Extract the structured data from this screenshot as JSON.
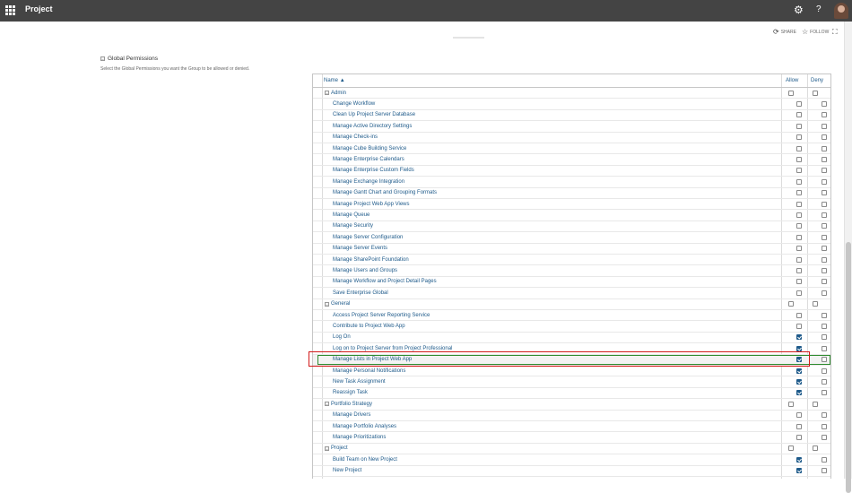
{
  "app": {
    "title": "Project"
  },
  "page_actions": {
    "share": "SHARE",
    "follow": "FOLLOW"
  },
  "section": {
    "title": "Global Permissions",
    "description": "Select the Global Permissions you want the Group to be allowed or denied."
  },
  "table": {
    "col_name": "Name",
    "col_allow": "Allow",
    "col_deny": "Deny",
    "rows": [
      {
        "type": "category",
        "label": "Admin",
        "allow": false,
        "deny": false
      },
      {
        "type": "perm",
        "label": "Change Workflow",
        "allow": false,
        "deny": false
      },
      {
        "type": "perm",
        "label": "Clean Up Project Server Database",
        "allow": false,
        "deny": false
      },
      {
        "type": "perm",
        "label": "Manage Active Directory Settings",
        "allow": false,
        "deny": false
      },
      {
        "type": "perm",
        "label": "Manage Check-ins",
        "allow": false,
        "deny": false
      },
      {
        "type": "perm",
        "label": "Manage Cube Building Service",
        "allow": false,
        "deny": false
      },
      {
        "type": "perm",
        "label": "Manage Enterprise Calendars",
        "allow": false,
        "deny": false
      },
      {
        "type": "perm",
        "label": "Manage Enterprise Custom Fields",
        "allow": false,
        "deny": false
      },
      {
        "type": "perm",
        "label": "Manage Exchange Integration",
        "allow": false,
        "deny": false
      },
      {
        "type": "perm",
        "label": "Manage Gantt Chart and Grouping Formats",
        "allow": false,
        "deny": false
      },
      {
        "type": "perm",
        "label": "Manage Project Web App Views",
        "allow": false,
        "deny": false
      },
      {
        "type": "perm",
        "label": "Manage Queue",
        "allow": false,
        "deny": false
      },
      {
        "type": "perm",
        "label": "Manage Security",
        "allow": false,
        "deny": false
      },
      {
        "type": "perm",
        "label": "Manage Server Configuration",
        "allow": false,
        "deny": false
      },
      {
        "type": "perm",
        "label": "Manage Server Events",
        "allow": false,
        "deny": false
      },
      {
        "type": "perm",
        "label": "Manage SharePoint Foundation",
        "allow": false,
        "deny": false
      },
      {
        "type": "perm",
        "label": "Manage Users and Groups",
        "allow": false,
        "deny": false
      },
      {
        "type": "perm",
        "label": "Manage Workflow and Project Detail Pages",
        "allow": false,
        "deny": false
      },
      {
        "type": "perm",
        "label": "Save Enterprise Global",
        "allow": false,
        "deny": false
      },
      {
        "type": "category",
        "label": "General",
        "allow": false,
        "deny": false
      },
      {
        "type": "perm",
        "label": "Access Project Server Reporting Service",
        "allow": false,
        "deny": false
      },
      {
        "type": "perm",
        "label": "Contribute to Project Web App",
        "allow": false,
        "deny": false
      },
      {
        "type": "perm",
        "label": "Log On",
        "allow": true,
        "deny": false
      },
      {
        "type": "perm",
        "label": "Log on to Project Server from Project Professional",
        "allow": true,
        "deny": false
      },
      {
        "type": "perm",
        "label": "Manage Lists in Project Web App",
        "allow": true,
        "deny": false,
        "selected": true
      },
      {
        "type": "perm",
        "label": "Manage Personal Notifications",
        "allow": true,
        "deny": false
      },
      {
        "type": "perm",
        "label": "New Task Assignment",
        "allow": true,
        "deny": false
      },
      {
        "type": "perm",
        "label": "Reassign Task",
        "allow": true,
        "deny": false
      },
      {
        "type": "category",
        "label": "Portfolio Strategy",
        "allow": false,
        "deny": false
      },
      {
        "type": "perm",
        "label": "Manage Drivers",
        "allow": false,
        "deny": false
      },
      {
        "type": "perm",
        "label": "Manage Portfolio Analyses",
        "allow": false,
        "deny": false
      },
      {
        "type": "perm",
        "label": "Manage Prioritizations",
        "allow": false,
        "deny": false
      },
      {
        "type": "category",
        "label": "Project",
        "allow": false,
        "deny": false
      },
      {
        "type": "perm",
        "label": "Build Team on New Project",
        "allow": true,
        "deny": false
      },
      {
        "type": "perm",
        "label": "New Project",
        "allow": true,
        "deny": false
      }
    ]
  }
}
